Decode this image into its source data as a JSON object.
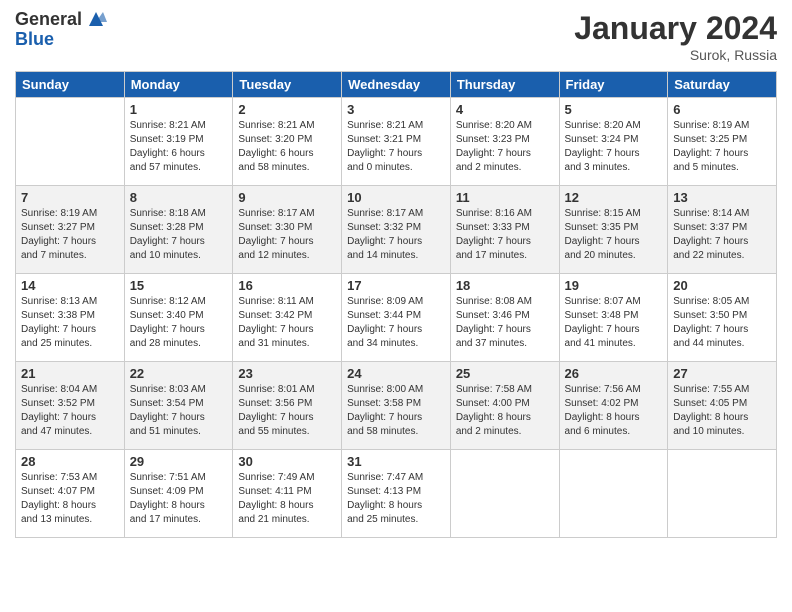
{
  "header": {
    "logo_general": "General",
    "logo_blue": "Blue",
    "month_title": "January 2024",
    "location": "Surok, Russia"
  },
  "columns": [
    "Sunday",
    "Monday",
    "Tuesday",
    "Wednesday",
    "Thursday",
    "Friday",
    "Saturday"
  ],
  "weeks": [
    [
      {
        "day": "",
        "info": ""
      },
      {
        "day": "1",
        "info": "Sunrise: 8:21 AM\nSunset: 3:19 PM\nDaylight: 6 hours\nand 57 minutes."
      },
      {
        "day": "2",
        "info": "Sunrise: 8:21 AM\nSunset: 3:20 PM\nDaylight: 6 hours\nand 58 minutes."
      },
      {
        "day": "3",
        "info": "Sunrise: 8:21 AM\nSunset: 3:21 PM\nDaylight: 7 hours\nand 0 minutes."
      },
      {
        "day": "4",
        "info": "Sunrise: 8:20 AM\nSunset: 3:23 PM\nDaylight: 7 hours\nand 2 minutes."
      },
      {
        "day": "5",
        "info": "Sunrise: 8:20 AM\nSunset: 3:24 PM\nDaylight: 7 hours\nand 3 minutes."
      },
      {
        "day": "6",
        "info": "Sunrise: 8:19 AM\nSunset: 3:25 PM\nDaylight: 7 hours\nand 5 minutes."
      }
    ],
    [
      {
        "day": "7",
        "info": "Sunrise: 8:19 AM\nSunset: 3:27 PM\nDaylight: 7 hours\nand 7 minutes."
      },
      {
        "day": "8",
        "info": "Sunrise: 8:18 AM\nSunset: 3:28 PM\nDaylight: 7 hours\nand 10 minutes."
      },
      {
        "day": "9",
        "info": "Sunrise: 8:17 AM\nSunset: 3:30 PM\nDaylight: 7 hours\nand 12 minutes."
      },
      {
        "day": "10",
        "info": "Sunrise: 8:17 AM\nSunset: 3:32 PM\nDaylight: 7 hours\nand 14 minutes."
      },
      {
        "day": "11",
        "info": "Sunrise: 8:16 AM\nSunset: 3:33 PM\nDaylight: 7 hours\nand 17 minutes."
      },
      {
        "day": "12",
        "info": "Sunrise: 8:15 AM\nSunset: 3:35 PM\nDaylight: 7 hours\nand 20 minutes."
      },
      {
        "day": "13",
        "info": "Sunrise: 8:14 AM\nSunset: 3:37 PM\nDaylight: 7 hours\nand 22 minutes."
      }
    ],
    [
      {
        "day": "14",
        "info": "Sunrise: 8:13 AM\nSunset: 3:38 PM\nDaylight: 7 hours\nand 25 minutes."
      },
      {
        "day": "15",
        "info": "Sunrise: 8:12 AM\nSunset: 3:40 PM\nDaylight: 7 hours\nand 28 minutes."
      },
      {
        "day": "16",
        "info": "Sunrise: 8:11 AM\nSunset: 3:42 PM\nDaylight: 7 hours\nand 31 minutes."
      },
      {
        "day": "17",
        "info": "Sunrise: 8:09 AM\nSunset: 3:44 PM\nDaylight: 7 hours\nand 34 minutes."
      },
      {
        "day": "18",
        "info": "Sunrise: 8:08 AM\nSunset: 3:46 PM\nDaylight: 7 hours\nand 37 minutes."
      },
      {
        "day": "19",
        "info": "Sunrise: 8:07 AM\nSunset: 3:48 PM\nDaylight: 7 hours\nand 41 minutes."
      },
      {
        "day": "20",
        "info": "Sunrise: 8:05 AM\nSunset: 3:50 PM\nDaylight: 7 hours\nand 44 minutes."
      }
    ],
    [
      {
        "day": "21",
        "info": "Sunrise: 8:04 AM\nSunset: 3:52 PM\nDaylight: 7 hours\nand 47 minutes."
      },
      {
        "day": "22",
        "info": "Sunrise: 8:03 AM\nSunset: 3:54 PM\nDaylight: 7 hours\nand 51 minutes."
      },
      {
        "day": "23",
        "info": "Sunrise: 8:01 AM\nSunset: 3:56 PM\nDaylight: 7 hours\nand 55 minutes."
      },
      {
        "day": "24",
        "info": "Sunrise: 8:00 AM\nSunset: 3:58 PM\nDaylight: 7 hours\nand 58 minutes."
      },
      {
        "day": "25",
        "info": "Sunrise: 7:58 AM\nSunset: 4:00 PM\nDaylight: 8 hours\nand 2 minutes."
      },
      {
        "day": "26",
        "info": "Sunrise: 7:56 AM\nSunset: 4:02 PM\nDaylight: 8 hours\nand 6 minutes."
      },
      {
        "day": "27",
        "info": "Sunrise: 7:55 AM\nSunset: 4:05 PM\nDaylight: 8 hours\nand 10 minutes."
      }
    ],
    [
      {
        "day": "28",
        "info": "Sunrise: 7:53 AM\nSunset: 4:07 PM\nDaylight: 8 hours\nand 13 minutes."
      },
      {
        "day": "29",
        "info": "Sunrise: 7:51 AM\nSunset: 4:09 PM\nDaylight: 8 hours\nand 17 minutes."
      },
      {
        "day": "30",
        "info": "Sunrise: 7:49 AM\nSunset: 4:11 PM\nDaylight: 8 hours\nand 21 minutes."
      },
      {
        "day": "31",
        "info": "Sunrise: 7:47 AM\nSunset: 4:13 PM\nDaylight: 8 hours\nand 25 minutes."
      },
      {
        "day": "",
        "info": ""
      },
      {
        "day": "",
        "info": ""
      },
      {
        "day": "",
        "info": ""
      }
    ]
  ]
}
